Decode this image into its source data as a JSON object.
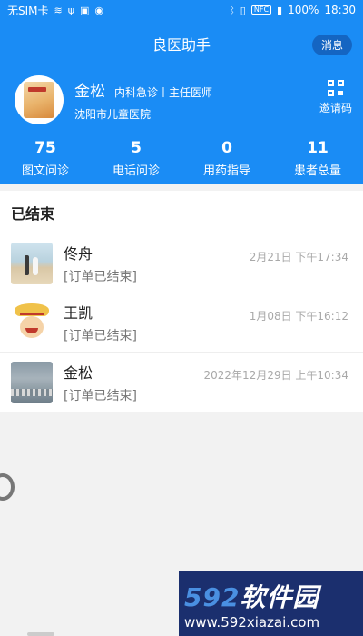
{
  "statusbar": {
    "carrier": "无SIM卡",
    "battery": "100%",
    "time": "18:30",
    "icons": [
      "wifi-icon",
      "usb-icon",
      "image-icon",
      "android-icon",
      "bluetooth-icon",
      "vibrate-icon",
      "nfc-icon",
      "battery-icon"
    ]
  },
  "header": {
    "title": "良医助手",
    "message_btn": "消息"
  },
  "profile": {
    "name": "金松",
    "dept": "内科急诊丨主任医师",
    "hospital": "沈阳市儿童医院",
    "invite_label": "邀请码"
  },
  "stats": [
    {
      "value": "75",
      "label": "图文问诊"
    },
    {
      "value": "5",
      "label": "电话问诊"
    },
    {
      "value": "0",
      "label": "用药指导"
    },
    {
      "value": "11",
      "label": "患者总量"
    }
  ],
  "section": {
    "title": "已结束",
    "items": [
      {
        "name": "佟舟",
        "status": "[订单已结束]",
        "time": "2月21日 下午17:34"
      },
      {
        "name": "王凯",
        "status": "[订单已结束]",
        "time": "1月08日 下午16:12"
      },
      {
        "name": "金松",
        "status": "[订单已结束]",
        "time": "2022年12月29日 上午10:34"
      }
    ]
  },
  "watermark": {
    "logo_num": "592",
    "logo_text": "软件园",
    "url": "www.592xiazai.com"
  },
  "colors": {
    "primary": "#1a8cf5",
    "message_btn": "#1465c2",
    "watermark_bg": "#1b2f6e"
  }
}
